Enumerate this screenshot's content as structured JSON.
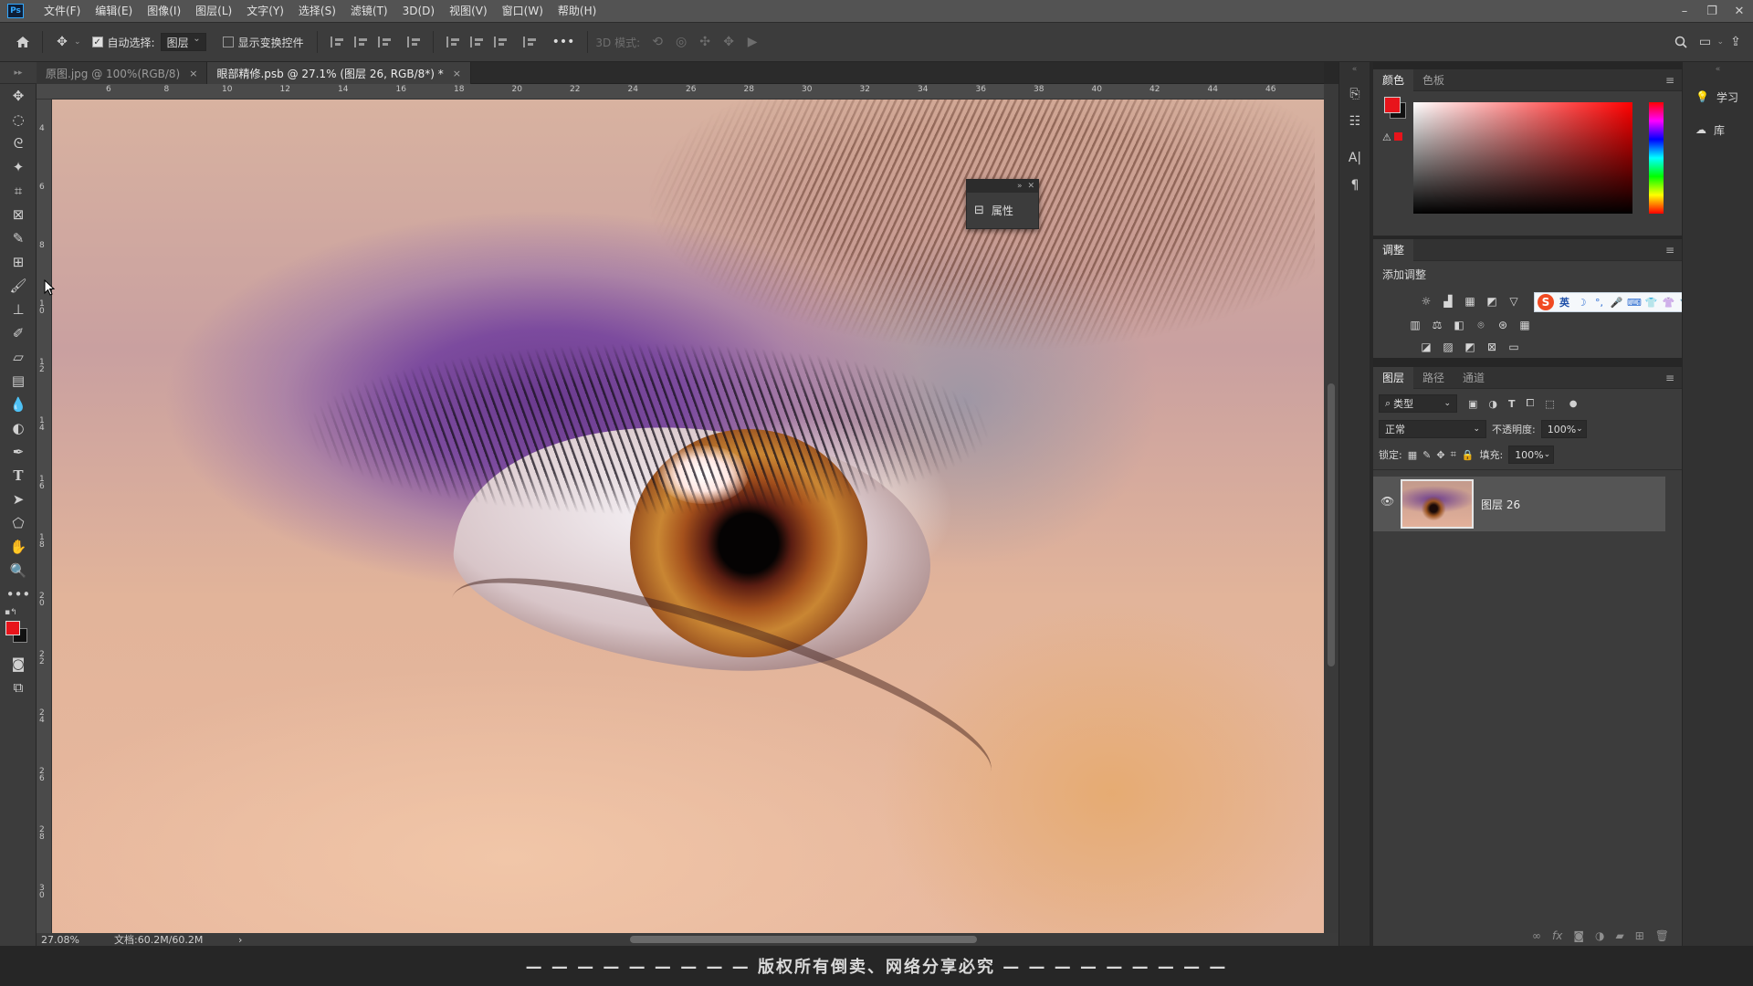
{
  "menubar": {
    "logo": "Ps",
    "items": [
      "文件(F)",
      "编辑(E)",
      "图像(I)",
      "图层(L)",
      "文字(Y)",
      "选择(S)",
      "滤镜(T)",
      "3D(D)",
      "视图(V)",
      "窗口(W)",
      "帮助(H)"
    ]
  },
  "options": {
    "auto_select_label": "自动选择:",
    "auto_select_checked": true,
    "auto_select_value": "图层",
    "show_transform_label": "显示变换控件",
    "show_transform_checked": false,
    "more": "•••",
    "mode3d_label": "3D 模式:"
  },
  "tabs": [
    {
      "label": "原图.jpg @ 100%(RGB/8)",
      "close": "×",
      "active": false
    },
    {
      "label": "眼部精修.psb @ 27.1% (图层 26, RGB/8*) *",
      "close": "×",
      "active": true
    }
  ],
  "ruler": {
    "top_labels": [
      "6",
      "8",
      "10",
      "12",
      "14",
      "16",
      "18",
      "20",
      "22",
      "24",
      "26",
      "28",
      "30",
      "32",
      "34",
      "36",
      "38",
      "40",
      "42",
      "44",
      "46"
    ],
    "left_labels": [
      "4",
      "6",
      "8",
      "1\n0",
      "1\n2",
      "1\n4",
      "1\n6",
      "1\n8",
      "2\n0",
      "2\n2",
      "2\n4",
      "2\n6",
      "2\n8",
      "3\n0"
    ]
  },
  "properties_float": {
    "label": "属性"
  },
  "status": {
    "zoom": "27.08%",
    "doc": "文档:60.2M/60.2M",
    "arrow": "›"
  },
  "color_panel": {
    "tabs": [
      "颜色",
      "色板"
    ],
    "foreground": "#e8141b",
    "background": "#111111"
  },
  "adjustments_panel": {
    "tabs": [
      "调整"
    ],
    "add_label": "添加调整",
    "ime": {
      "logo": "S",
      "lang": "英"
    }
  },
  "layers_panel": {
    "tabs": [
      "图层",
      "路径",
      "通道"
    ],
    "filter_kind": "类型",
    "blend_mode": "正常",
    "opacity_label": "不透明度:",
    "opacity_value": "100%",
    "lock_label": "锁定:",
    "fill_label": "填充:",
    "fill_value": "100%",
    "layers": [
      {
        "name": "图层 26",
        "visible": true
      }
    ],
    "footer_icons": [
      "∞",
      "fx"
    ]
  },
  "learn_strip": {
    "items": [
      "学习",
      "库"
    ]
  },
  "watermark": "— — — — — — — — — 版权所有倒卖、网络分享必究 — — — — — — — — —"
}
